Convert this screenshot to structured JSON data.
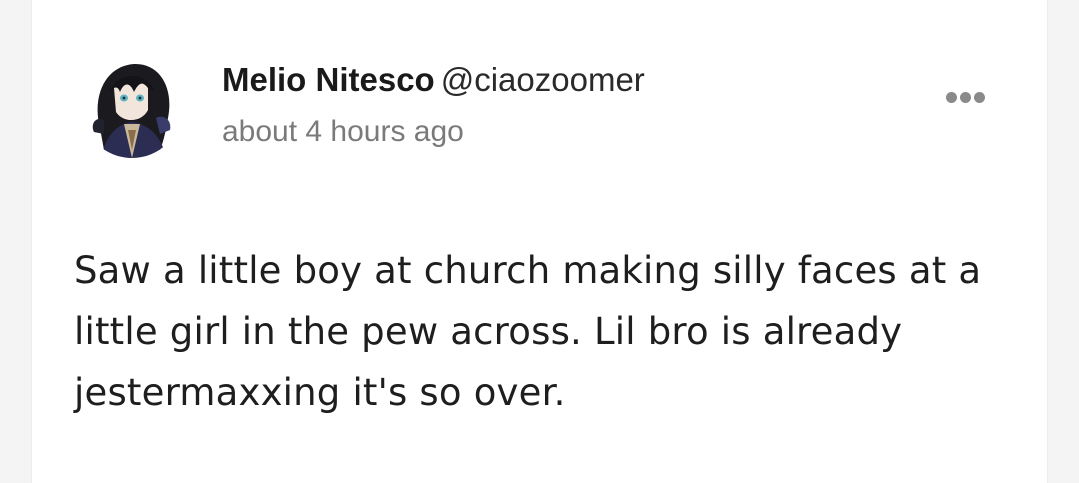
{
  "post": {
    "author": {
      "display_name": "Melio Nitesco",
      "handle": "@ciaozoomer",
      "avatar_icon": "anime-character-avatar"
    },
    "timestamp": "about 4 hours ago",
    "menu_icon": "more-options-icon",
    "body": "Saw a little boy at church making silly faces at a little girl in the pew across. Lil bro is already jestermaxxing it's so over."
  },
  "colors": {
    "background": "#f4f4f4",
    "card": "#ffffff",
    "text_primary": "#1e1e1e",
    "text_secondary": "#7a7a7a",
    "menu_dots": "#8a8a8a"
  }
}
